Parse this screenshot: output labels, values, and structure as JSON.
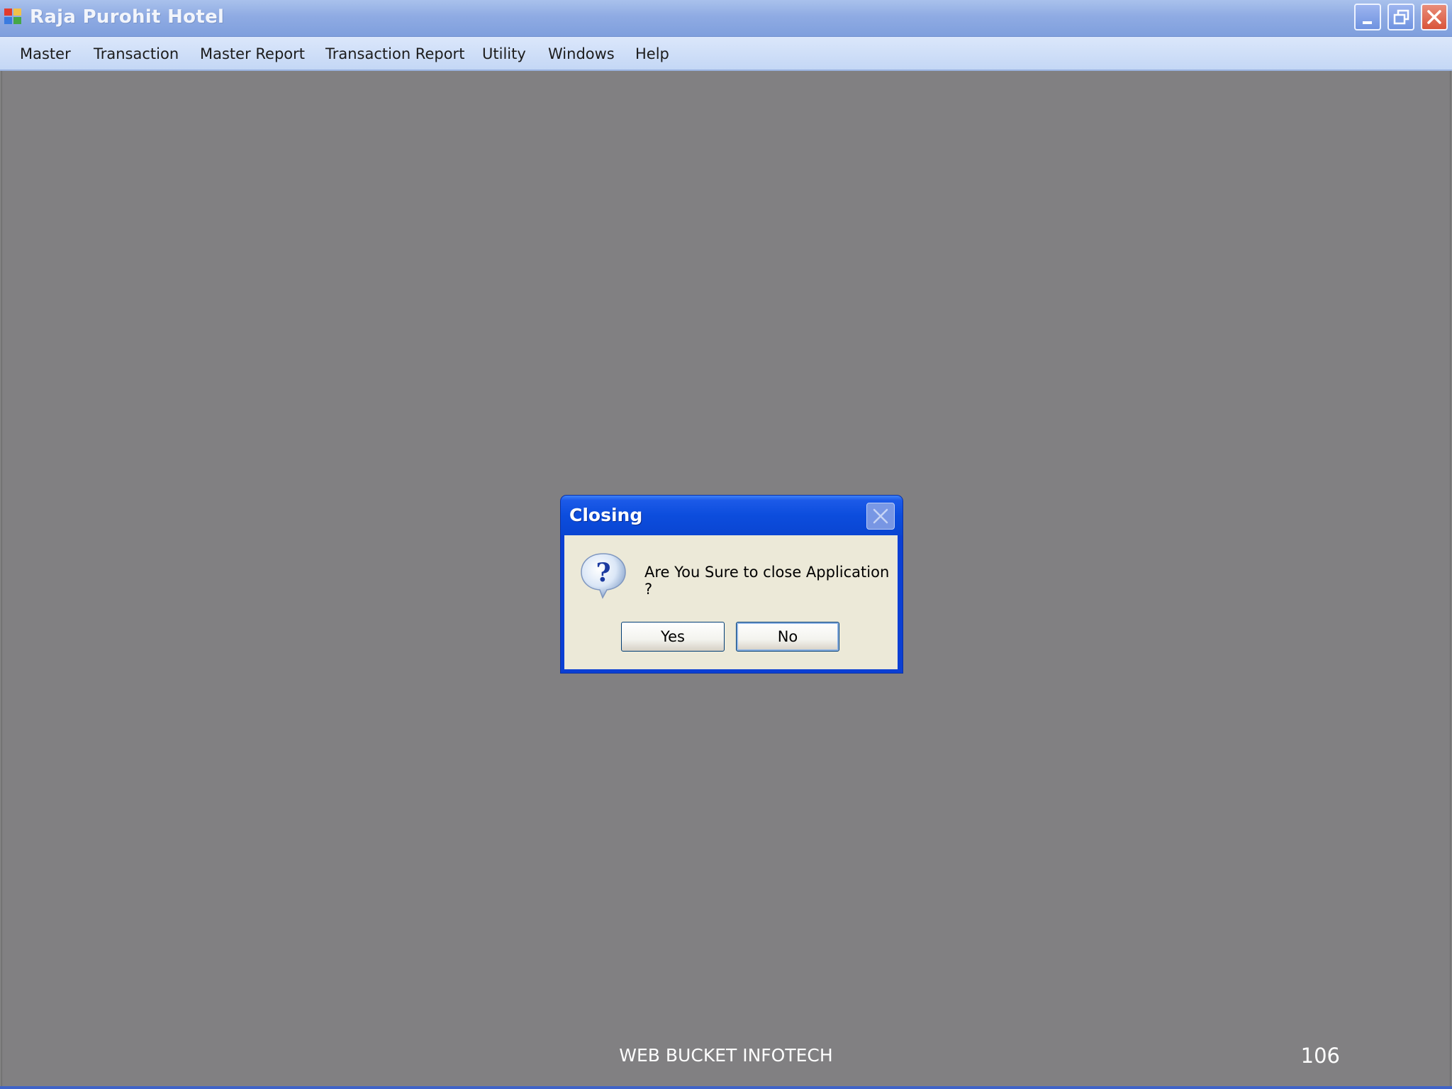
{
  "window": {
    "title": "Raja Purohit Hotel",
    "controls": [
      "minimize-icon",
      "restore-icon",
      "close-icon"
    ]
  },
  "menu": {
    "items": [
      {
        "label": "Master"
      },
      {
        "label": "Transaction"
      },
      {
        "label": "Master Report"
      },
      {
        "label": "Transaction Report"
      },
      {
        "label": "Utility"
      },
      {
        "label": "Windows"
      },
      {
        "label": "Help"
      }
    ]
  },
  "dialog": {
    "title": "Closing",
    "message": "Are You Sure to close Application ?",
    "icon": "question-icon",
    "yes_label": "Yes",
    "no_label": "No"
  },
  "footer": {
    "company": "WEB BUCKET INFOTECH",
    "number": "106"
  },
  "colors": {
    "workspace": "#818082",
    "titlebar": "#8fabe3",
    "dialog_title": "#0c4ddd",
    "dialog_body": "#ece9d8"
  }
}
